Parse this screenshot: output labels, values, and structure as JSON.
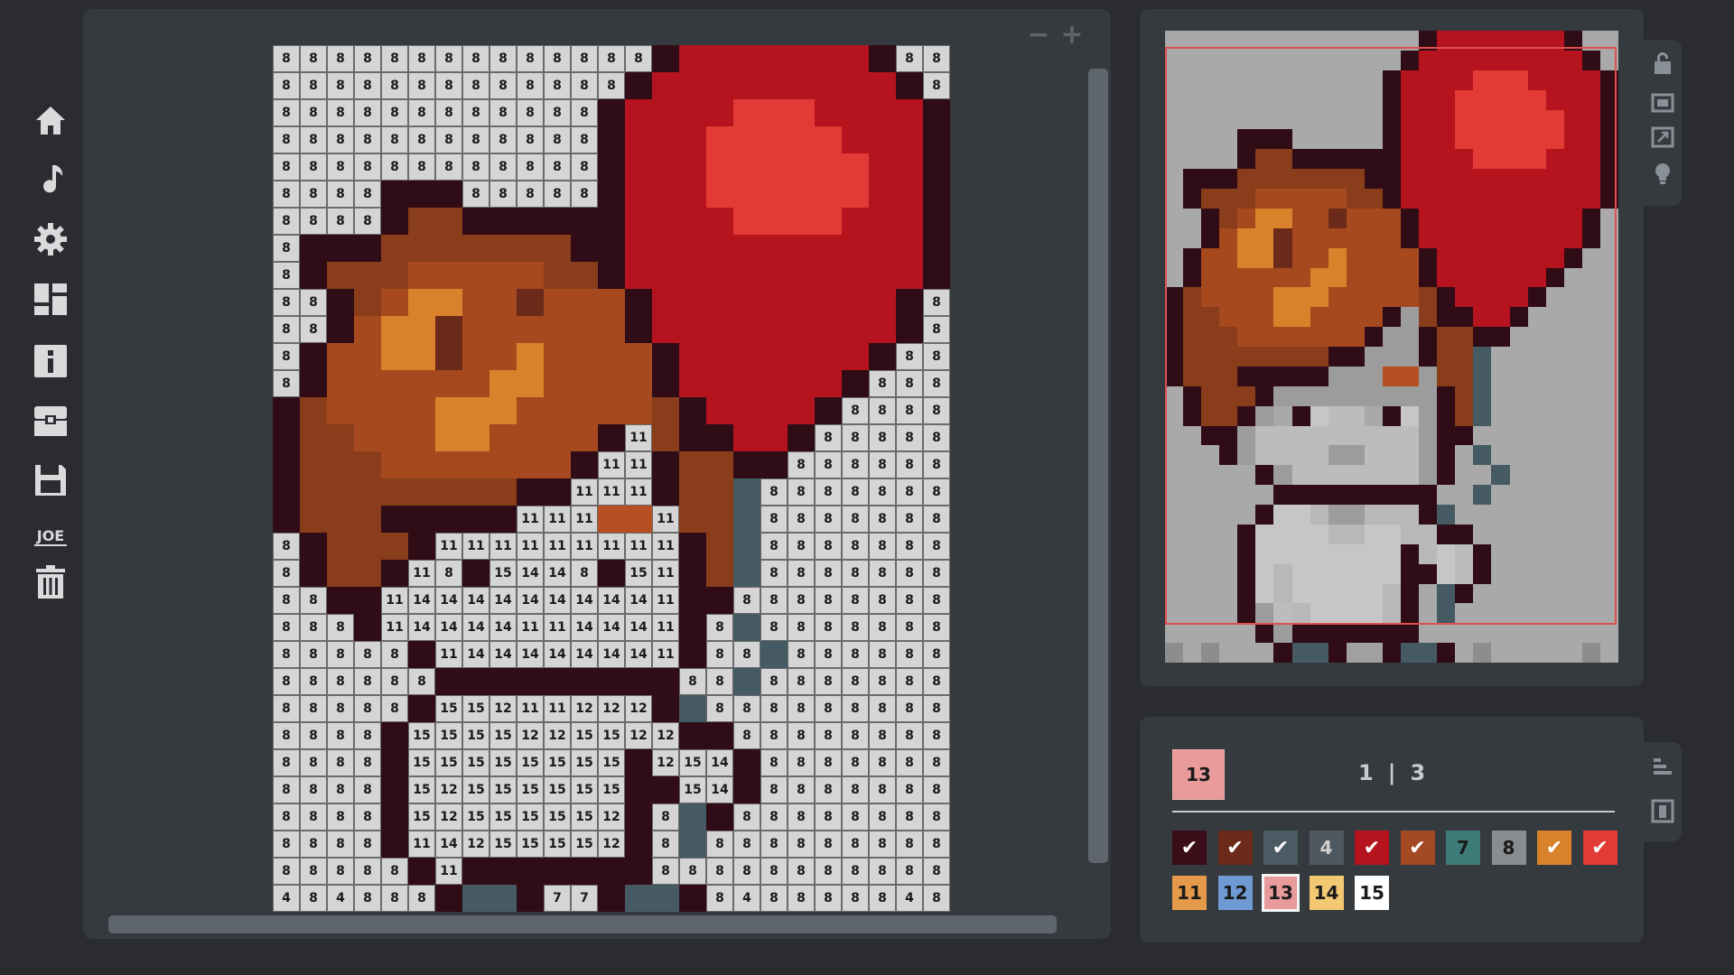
{
  "sidebar": {
    "items": [
      {
        "name": "home",
        "icon": "home-icon"
      },
      {
        "name": "music",
        "icon": "music-note-icon"
      },
      {
        "name": "settings",
        "icon": "gear-icon"
      },
      {
        "name": "dashboard",
        "icon": "grid-icon"
      },
      {
        "name": "info",
        "icon": "info-icon"
      },
      {
        "name": "inventory",
        "icon": "chest-icon"
      },
      {
        "name": "save",
        "icon": "floppy-disk-icon"
      },
      {
        "name": "logo",
        "icon": "joe-logo-icon",
        "text": "JOE"
      },
      {
        "name": "delete",
        "icon": "trash-icon"
      }
    ]
  },
  "zoom": {
    "minus": "−",
    "plus": "+"
  },
  "palette": {
    "current": "13",
    "current_color": "#e99a9a",
    "page": "1",
    "separator": "|",
    "total_pages": "3",
    "colors": [
      {
        "id": "1",
        "label": "",
        "color": "#3a0d18",
        "done": true,
        "text_color": "#ffffff"
      },
      {
        "id": "2",
        "label": "",
        "color": "#6b2a1a",
        "done": true,
        "text_color": "#ffffff"
      },
      {
        "id": "3",
        "label": "",
        "color": "#4a5b63",
        "done": true,
        "text_color": "#ffffff"
      },
      {
        "id": "4",
        "label": "4",
        "color": "#4e5860",
        "done": false,
        "text_color": "#d0d0d0"
      },
      {
        "id": "5",
        "label": "",
        "color": "#b5141f",
        "done": true,
        "text_color": "#ffffff"
      },
      {
        "id": "6",
        "label": "",
        "color": "#a34a24",
        "done": true,
        "text_color": "#ffffff"
      },
      {
        "id": "7",
        "label": "7",
        "color": "#3e7c7a",
        "done": false,
        "text_color": "#1a1a1a"
      },
      {
        "id": "8",
        "label": "8",
        "color": "#8a8d90",
        "done": false,
        "text_color": "#1a1a1a"
      },
      {
        "id": "9",
        "label": "",
        "color": "#d9822b",
        "done": true,
        "text_color": "#1a1a1a"
      },
      {
        "id": "10",
        "label": "",
        "color": "#e23a34",
        "done": true,
        "text_color": "#1a1a1a"
      },
      {
        "id": "11",
        "label": "11",
        "color": "#e49a4a",
        "done": false,
        "text_color": "#1a1a1a"
      },
      {
        "id": "12",
        "label": "12",
        "color": "#6f9ad4",
        "done": false,
        "text_color": "#1a1a1a"
      },
      {
        "id": "13",
        "label": "13",
        "color": "#e99a9a",
        "done": false,
        "text_color": "#1a1a1a"
      },
      {
        "id": "14",
        "label": "14",
        "color": "#f2c872",
        "done": false,
        "text_color": "#1a1a1a"
      },
      {
        "id": "15",
        "label": "15",
        "color": "#ffffff",
        "done": false,
        "text_color": "#1a1a1a"
      }
    ]
  },
  "grid": {
    "colors": {
      "D": "#2f0c16",
      "R": "#b5141f",
      "B": "#e23a34",
      "P": "#ec8f8f",
      "M": "#8a3d1b",
      "N": "#a6491f",
      "O": "#d9822b",
      "K": "#6b2a1a",
      "S": "#455a63",
      "A": "#b64f22"
    },
    "rows": [
      "8 8 8 8 8 8 8 8 8 8 8 8 8 8 D R R R R R R R D 8 8",
      "8 8 8 8 8 8 8 8 8 8 8 8 8 D R R R R R R R R R D 8",
      "8 8 8 8 8 8 8 8 8 8 8 8 D R R R R B B B R R R R D",
      "8 8 8 8 8 8 8 8 8 8 8 8 D R R R B B B B B R R R D",
      "8 8 8 8 8 8 8 8 8 8 8 8 D R R R B B B B B B R R D",
      "8 8 8 8 D D D 8 8 8 8 8 D R R R B B B B B B R R D",
      "8 8 8 8 D M M D D D D D D R R R R B B B B R R R D",
      "8 D D D M M M M M M M D D R R R R R R R R R R R D",
      "8 D M M M N N N N N M M D R R R R R R R R R R R D",
      "8 8 D M N O O N N K N N N D R R R R R R R R R D 8",
      "8 8 D N O O K N N N N N N D R R R R R R R R R D 8",
      "8 D N N O O K N N O N N N N D R R R R R R R D 8 8",
      "8 D N N N N N N O O N N N N D R R R R R R D 8 8 8",
      "D M N N N N O O O N N N N N M D R R R R D 8 8 8 8",
      "D M M N N N O O N N N N D 11 M D D R R D 8 8 8 8 8",
      "D M M M N N N N N N N D 11 11 D M M D D 8 8 8 8 8 8",
      "D M M M M M M M M D D 11 11 11 D M M S 8 8 8 8 8 8 8",
      "D M M M D D D D D 11 11 11 A A 11 M M S 8 8 8 8 8 8 8",
      "8 D M M M D 11 11 11 11 11 11 11 11 11 D M S 8 8 8 8 8 8 8",
      "8 D M M D 11 8 D 15 14 14 8 D 15 11 D M S 8 8 8 8 8 8 8",
      "8 8 D D 11 14 14 14 14 14 14 14 14 14 11 D D 8 8 8 8 8 8 8 8",
      "8 8 8 D 11 14 14 14 14 11 11 14 14 14 11 D 8 S 8 8 8 8 8 8 8",
      "8 8 8 8 8 D 11 14 14 14 14 14 14 14 11 D 8 8 S 8 8 8 8 8 8",
      "8 8 8 8 8 8 D D D D D D D D D 8 8 S 8 8 8 8 8 8 8",
      "8 8 8 8 8 D 15 15 12 11 11 12 12 12 D S 8 8 8 8 8 8 8 8 8",
      "8 8 8 8 D 15 15 15 15 12 12 15 15 12 12 D D 8 8 8 8 8 8 8 8",
      "8 8 8 8 D 15 15 15 15 15 15 15 15 D 12 15 14 D 8 8 8 8 8 8 8",
      "8 8 8 8 D 15 12 15 15 15 15 15 15 D D 15 14 D 8 8 8 8 8 8 8",
      "8 8 8 8 D 15 12 15 15 15 15 15 12 D 8 S D 8 8 8 8 8 8 8 8",
      "8 8 8 8 D 11 14 12 15 15 15 15 12 D 8 S 8 8 8 8 8 8 8 8 8",
      "8 8 8 8 8 D 11 D D D D D D D 8 8 8 8 8 8 8 8 8 8 8",
      "4 8 4 8 8 8 D S S D 7 7 D S S D 8 4 8 8 8 8 8 4 8 8"
    ]
  },
  "preview": {
    "colors": {
      "8": "#a9a9a9",
      "4": "#8d8d8d",
      "11": "#9c9c9c",
      "12": "#b8b8b8",
      "14": "#bcbcbc",
      "15": "#c6c6c6",
      "7": "#a0a0a0"
    }
  }
}
